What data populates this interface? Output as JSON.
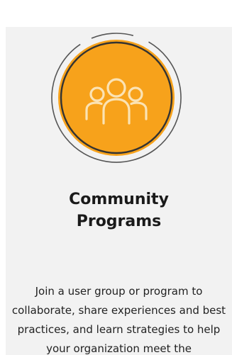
{
  "program_card": {
    "icon": "community-group-icon",
    "title_line1": "Community",
    "title_line2": "Programs",
    "description": "Join a user group or program to collaborate, share experiences and best practices, and learn strategies to help your organization meet the",
    "colors": {
      "card_background": "#f2f2f2",
      "emblem_fill": "#f7a21b",
      "emblem_ring": "#333333",
      "emblem_glyph": "#fbe3b4"
    }
  }
}
